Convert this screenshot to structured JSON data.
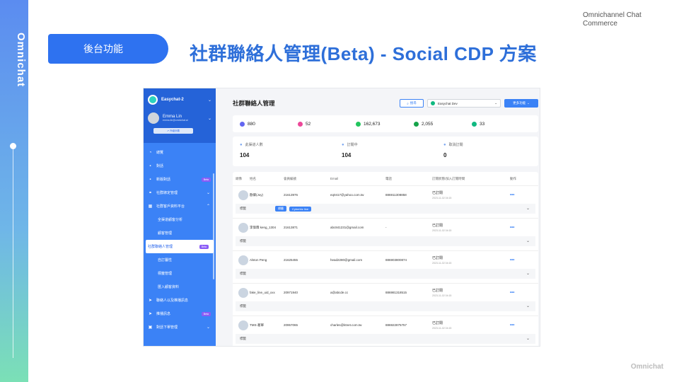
{
  "brand": {
    "logo_text": "Omnichat",
    "topright_line1": "Omnichannel Chat",
    "topright_line2": "Commerce",
    "footer_mark": "Omnichat"
  },
  "slide": {
    "tag": "後台功能",
    "title": "社群聯絡人管理(Beta) - Social CDP 方案"
  },
  "sidebar": {
    "workspace": "Easychat-2",
    "user_name": "Emma Lin",
    "user_email": "emma.lin@omnichat.ai",
    "subscribe_button": "↗ 升級計劃",
    "items": [
      {
        "label": "總覽",
        "icon": "dashboard-icon",
        "glyph": "◔"
      },
      {
        "label": "對話",
        "icon": "chat-icon",
        "glyph": "▪"
      },
      {
        "label": "新版對話",
        "icon": "chat-new-icon",
        "glyph": "▪",
        "badge": "Beta"
      },
      {
        "label": "社群綁定管理",
        "icon": "link-icon",
        "glyph": "⚭",
        "chevron": "⌄"
      },
      {
        "label": "社群客戶資料平台",
        "icon": "cdp-icon",
        "glyph": "▦",
        "chevron": "⌃"
      },
      {
        "label": "全渠道顧客分析",
        "sub": true
      },
      {
        "label": "顧客管理",
        "sub": true
      },
      {
        "label": "社群聯絡人管理",
        "sub": true,
        "active": true,
        "badge": "Beta"
      },
      {
        "label": "自訂屬性",
        "sub": true
      },
      {
        "label": "標籤管理",
        "sub": true
      },
      {
        "label": "匯入顧客資料",
        "sub": true
      },
      {
        "label": "聯絡人以及推播訊息",
        "icon": "send-icon",
        "glyph": "➤"
      },
      {
        "label": "推播訊息",
        "icon": "broadcast-icon",
        "glyph": "➤",
        "badge": "Beta"
      },
      {
        "label": "對話下單管理",
        "icon": "order-icon",
        "glyph": "▣",
        "chevron": "⌄"
      }
    ]
  },
  "main": {
    "title": "社群聯絡人管理",
    "search_label": "搜尋",
    "channel_selected": "Easychat Dev",
    "more_label": "更多功能",
    "stats": [
      {
        "icon": "messenger-icon",
        "color": "#6366f1",
        "value": "880"
      },
      {
        "icon": "instagram-icon",
        "color": "#ec4899",
        "value": "52"
      },
      {
        "icon": "whatsapp-icon",
        "color": "#22c55e",
        "value": "162,673"
      },
      {
        "icon": "line-icon",
        "color": "#16a34a",
        "value": "2,055"
      },
      {
        "icon": "wechat-icon",
        "color": "#10b981",
        "value": "33"
      }
    ],
    "totals": [
      {
        "label": "此渠道人數",
        "value": "104"
      },
      {
        "label": "訂閱中",
        "value": "104"
      },
      {
        "label": "取消訂閱",
        "value": "0"
      }
    ],
    "columns": [
      "頭像",
      "姓名",
      "會員編號",
      "Email",
      "電話",
      "訂閱狀態/加入訂閱時間",
      "動作"
    ],
    "tags_label": "標籤",
    "rows": [
      {
        "name": "歐卿(Joy)",
        "id": "21613976",
        "email": "eq0417@yahoo.com.tw",
        "phone": "886911308858",
        "status": "已訂閱",
        "time": "2023-11-02 04:15",
        "tags": [
          "標籤",
          "Cyberbiz line"
        ]
      },
      {
        "name": "李偉霖 keng_1304",
        "id": "21613871",
        "email": "abc841231@gmail.com",
        "phone": "-",
        "status": "已訂閱",
        "time": "2023-11-02 04:15",
        "tags": []
      },
      {
        "name": "Alston Peng",
        "id": "21625455",
        "email": "head2280@gmail.com",
        "phone": "886903800874",
        "status": "已訂閱",
        "time": "2023-11-02 04:15",
        "tags": []
      },
      {
        "name": "fake_line_uid_xxx",
        "id": "20971940",
        "email": "a@abcde.cc",
        "phone": "886981318515",
        "status": "已訂閱",
        "time": "2023-11-02 04:15",
        "tags": []
      },
      {
        "name": "TMS-葛軍",
        "id": "20957065",
        "email": "charles@ktnet.com.tw",
        "phone": "886922875757",
        "status": "已訂閱",
        "time": "2023-11-02 04:15",
        "tags": []
      }
    ]
  }
}
